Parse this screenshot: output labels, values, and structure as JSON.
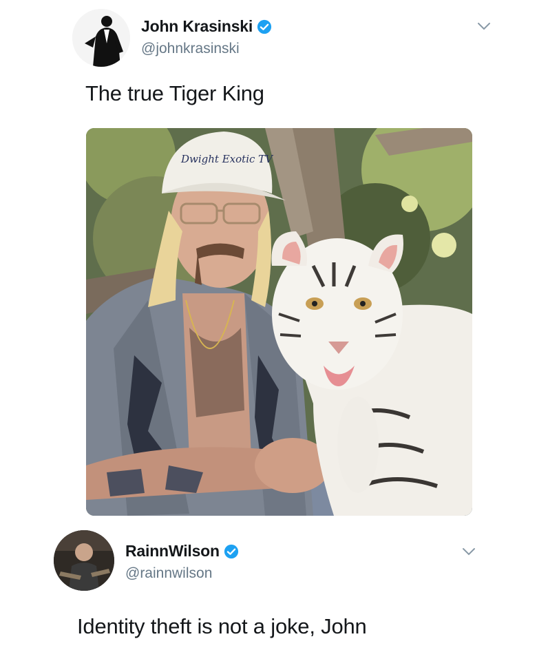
{
  "tweet1": {
    "display_name": "John Krasinski",
    "handle": "@johnkrasinski",
    "text": "The true Tiger King",
    "verified": true,
    "media": {
      "cap_text": "Dwight Exotic TV",
      "icon": "photo-man-with-white-tiger"
    }
  },
  "tweet2": {
    "display_name": "RainnWilson",
    "handle": "@rainnwilson",
    "text": "Identity theft is not a joke, John",
    "verified": true
  },
  "colors": {
    "verified_blue": "#1da1f2",
    "handle_gray": "#657786",
    "text_dark": "#14171a"
  }
}
